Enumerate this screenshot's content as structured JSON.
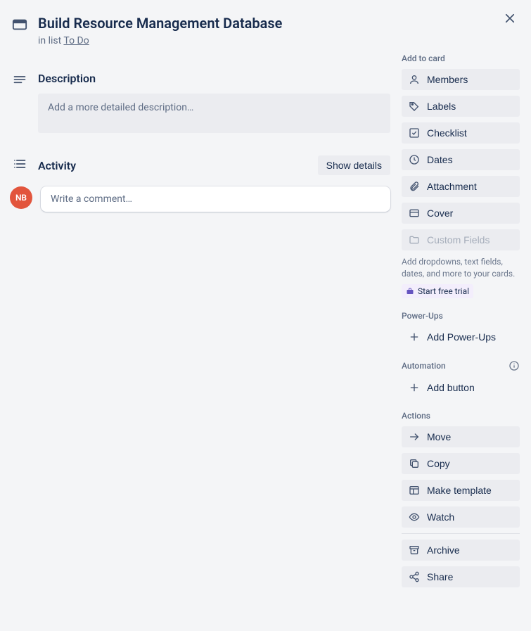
{
  "header": {
    "title": "Build Resource Management Database",
    "inListPrefix": "in list ",
    "listName": "To Do"
  },
  "description": {
    "heading": "Description",
    "placeholder": "Add a more detailed description…"
  },
  "activity": {
    "heading": "Activity",
    "showDetails": "Show details",
    "avatar": "NB",
    "commentPlaceholder": "Write a comment…"
  },
  "sidebar": {
    "addToCard": {
      "heading": "Add to card",
      "members": "Members",
      "labels": "Labels",
      "checklist": "Checklist",
      "dates": "Dates",
      "attachment": "Attachment",
      "cover": "Cover",
      "customFields": "Custom Fields",
      "note": "Add dropdowns, text fields, dates, and more to your cards.",
      "trial": "Start free trial"
    },
    "powerUps": {
      "heading": "Power-Ups",
      "add": "Add Power-Ups"
    },
    "automation": {
      "heading": "Automation",
      "addButton": "Add button"
    },
    "actions": {
      "heading": "Actions",
      "move": "Move",
      "copy": "Copy",
      "makeTemplate": "Make template",
      "watch": "Watch",
      "archive": "Archive",
      "share": "Share"
    }
  }
}
